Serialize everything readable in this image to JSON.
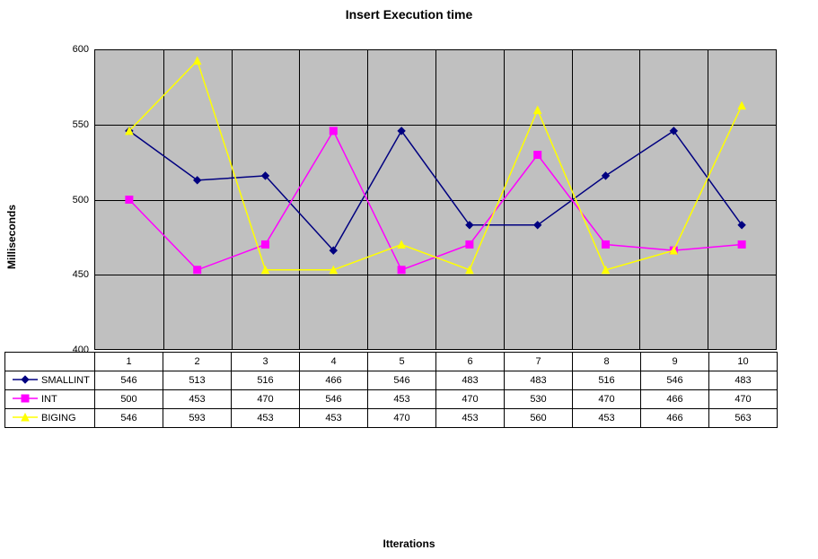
{
  "chart_data": {
    "type": "line",
    "title": "Insert Execution time",
    "xlabel": "Itterations",
    "ylabel": "Milliseconds",
    "categories": [
      "1",
      "2",
      "3",
      "4",
      "5",
      "6",
      "7",
      "8",
      "9",
      "10"
    ],
    "yticks": [
      400,
      450,
      500,
      550,
      600
    ],
    "ylim": [
      400,
      600
    ],
    "series": [
      {
        "name": "SMALLINT",
        "color": "#000080",
        "marker": "diamond",
        "values": [
          546,
          513,
          516,
          466,
          546,
          483,
          483,
          516,
          546,
          483
        ]
      },
      {
        "name": "INT",
        "color": "#ff00ff",
        "marker": "square",
        "values": [
          500,
          453,
          470,
          546,
          453,
          470,
          530,
          470,
          466,
          470
        ]
      },
      {
        "name": "BIGING",
        "color": "#ffff00",
        "marker": "triangle",
        "values": [
          546,
          593,
          453,
          453,
          470,
          453,
          560,
          453,
          466,
          563
        ]
      }
    ]
  }
}
